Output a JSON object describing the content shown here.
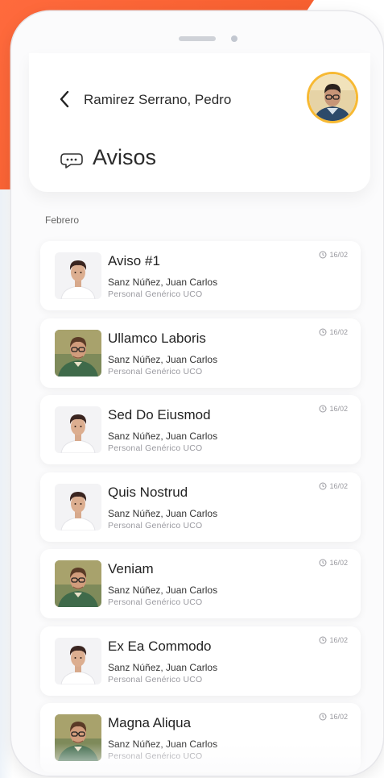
{
  "header": {
    "user_name": "Ramirez Serrano, Pedro",
    "title": "Avisos"
  },
  "month": "Febrero",
  "notices": [
    {
      "title": "Aviso #1",
      "author": "Sanz Núñez, Juan Carlos",
      "role": "Personal Genérico UCO",
      "date": "16/02",
      "avatar": "young-man-avatar"
    },
    {
      "title": "Ullamco Laboris",
      "author": "Sanz Núñez, Juan Carlos",
      "role": "Personal Genérico UCO",
      "date": "16/02",
      "avatar": "man-glasses-avatar"
    },
    {
      "title": "Sed Do Eiusmod",
      "author": "Sanz Núñez, Juan Carlos",
      "role": "Personal Genérico UCO",
      "date": "16/02",
      "avatar": "young-man-avatar"
    },
    {
      "title": "Quis Nostrud",
      "author": "Sanz Núñez, Juan Carlos",
      "role": "Personal Genérico UCO",
      "date": "16/02",
      "avatar": "young-man-avatar"
    },
    {
      "title": "Veniam",
      "author": "Sanz Núñez, Juan Carlos",
      "role": "Personal Genérico UCO",
      "date": "16/02",
      "avatar": "man-glasses-avatar"
    },
    {
      "title": "Ex Ea Commodo",
      "author": "Sanz Núñez, Juan Carlos",
      "role": "Personal Genérico UCO",
      "date": "16/02",
      "avatar": "young-man-avatar"
    },
    {
      "title": "Magna Aliqua",
      "author": "Sanz Núñez, Juan Carlos",
      "role": "Personal Genérico UCO",
      "date": "16/02",
      "avatar": "man-glasses-avatar"
    }
  ],
  "colors": {
    "accent": "#f25a28",
    "avatar_ring": "#f7b933"
  }
}
